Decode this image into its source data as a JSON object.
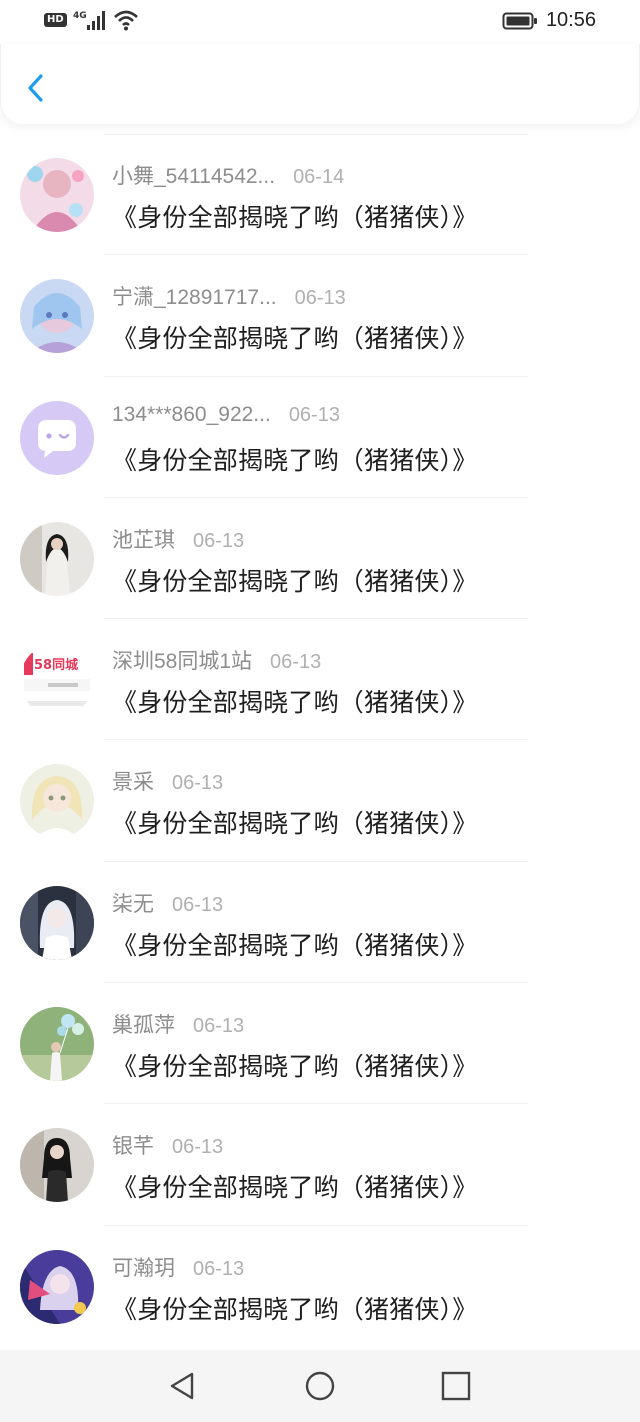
{
  "status_bar": {
    "hd": "HD",
    "network": "4G",
    "time": "10:56",
    "icons": [
      "hd-badge",
      "signal-icon",
      "wifi-icon",
      "battery-icon"
    ]
  },
  "header": {
    "back_icon": "chevron-left-icon",
    "accent_color": "#1e9cf0"
  },
  "items": [
    {
      "name": "小舞_54114542...",
      "date": "06-14",
      "message": "《身份全部揭晓了哟（猪猪侠）》",
      "avatar": "avatar-anime-pink"
    },
    {
      "name": "宁潇_12891717...",
      "date": "06-13",
      "message": "《身份全部揭晓了哟（猪猪侠）》",
      "avatar": "avatar-anime-blue"
    },
    {
      "name": "134***860_922...",
      "date": "06-13",
      "message": "《身份全部揭晓了哟（猪猪侠）》",
      "avatar": "avatar-default-chat"
    },
    {
      "name": "池芷琪",
      "date": "06-13",
      "message": "《身份全部揭晓了哟（猪猪侠）》",
      "avatar": "avatar-photo-girl"
    },
    {
      "name": "深圳58同城1站",
      "date": "06-13",
      "message": "《身份全部揭晓了哟（猪猪侠）》",
      "avatar": "avatar-58-logo",
      "avatar_text": "58同城"
    },
    {
      "name": "景采",
      "date": "06-13",
      "message": "《身份全部揭晓了哟（猪猪侠）》",
      "avatar": "avatar-anime-blonde"
    },
    {
      "name": "柒无",
      "date": "06-13",
      "message": "《身份全部揭晓了哟（猪猪侠）》",
      "avatar": "avatar-anime-white"
    },
    {
      "name": "巢孤萍",
      "date": "06-13",
      "message": "《身份全部揭晓了哟（猪猪侠）》",
      "avatar": "avatar-photo-balloons"
    },
    {
      "name": "银芊",
      "date": "06-13",
      "message": "《身份全部揭晓了哟（猪猪侠）》",
      "avatar": "avatar-photo-dark"
    },
    {
      "name": "可瀚玥",
      "date": "06-13",
      "message": "《身份全部揭晓了哟（猪猪侠）》",
      "avatar": "avatar-anime-purple"
    }
  ],
  "nav_bar": {
    "icons": [
      "back-triangle-icon",
      "home-circle-icon",
      "recents-square-icon"
    ]
  }
}
